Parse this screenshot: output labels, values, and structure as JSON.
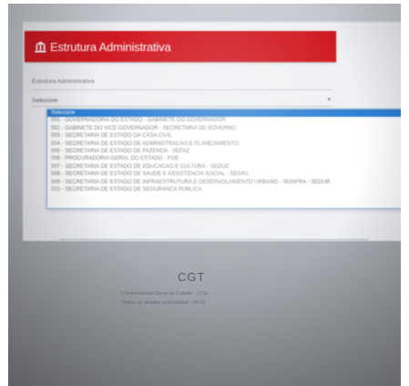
{
  "header": {
    "title": "Estrutura Administrativa",
    "icon": "building-icon",
    "color": "#d11a23"
  },
  "form": {
    "label": "Estrutura Administrativa",
    "select_value": "Selecione",
    "dropdown": {
      "selected_index": 0,
      "options": [
        "Selecione",
        "001 - GOVERNADORIA DO ESTADO - GABINETE DO GOVERNADOR",
        "002 - GABINETE DO VICE-GOVERNADOR - SECRETARIA DE GOVERNO",
        "003 - SECRETARIA DE ESTADO DA CASA CIVIL",
        "004 - SECRETARIA DE ESTADO DE ADMINISTRACAO E PLANEJAMENTO",
        "005 - SECRETARIA DE ESTADO DE FAZENDA - SEFAZ",
        "006 - PROCURADORIA GERAL DO ESTADO - PGE",
        "007 - SECRETARIA DE ESTADO DE EDUCACAO E CULTURA - SEDUC",
        "008 - SECRETARIA DE ESTADO DE SAUDE E ASSISTENCIA SOCIAL - SESAU",
        "009 - SECRETARIA DE ESTADO DE INFRAESTRUTURA E DESENVOLVIMENTO URBANO - SEINFRA - SEDUR",
        "010 - SECRETARIA DE ESTADO DE SEGURANCA PUBLICA"
      ]
    }
  },
  "footer": {
    "logo": "CGT",
    "line1": "Controladoria Geral do Estado - CGE",
    "line2": "Todos os direitos reservados - 2018"
  }
}
